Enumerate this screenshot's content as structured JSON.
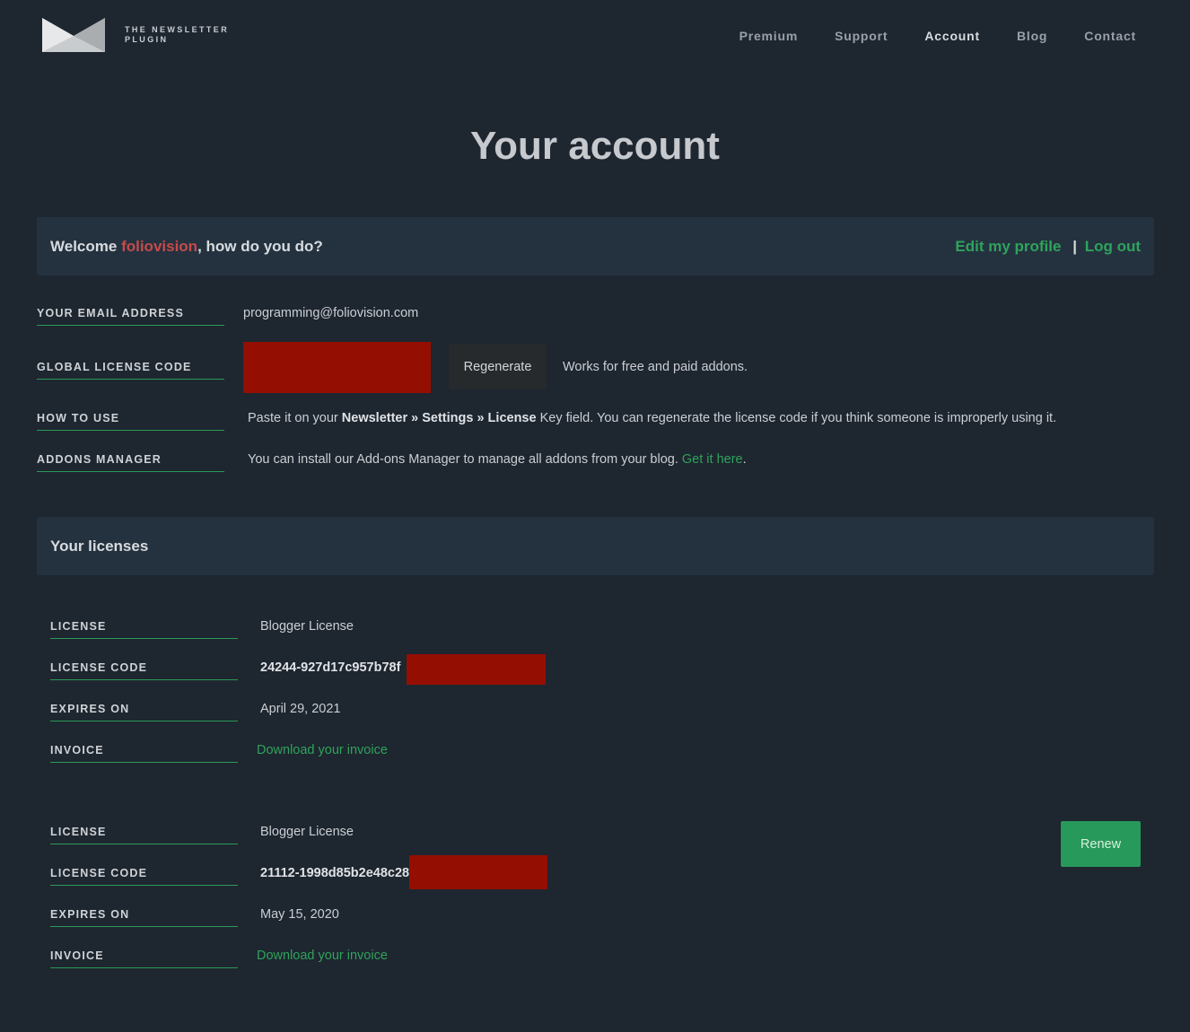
{
  "logo": {
    "line1": "THE NEWSLETTER",
    "line2": "PLUGIN",
    "icon": "envelope-logo-icon"
  },
  "nav": {
    "items": [
      "Premium",
      "Support",
      "Account",
      "Blog",
      "Contact"
    ],
    "active": "Account"
  },
  "page_title": "Your account",
  "welcome": {
    "prefix": "Welcome ",
    "username": "foliovision",
    "suffix": ", how do you do?",
    "edit_profile": "Edit my profile",
    "separator": "|",
    "logout": "Log out"
  },
  "account": {
    "email_label": "YOUR EMAIL ADDRESS",
    "email_value": "programming@foliovision.com",
    "license_label": "GLOBAL LICENSE CODE",
    "regenerate_label": "Regenerate",
    "license_note": "Works for free and paid addons.",
    "howto_label": "HOW TO USE",
    "howto_prefix": "Paste it on your ",
    "howto_bold": "Newsletter » Settings » License",
    "howto_suffix": " Key field. You can regenerate the license code if you think someone is improperly using it.",
    "addons_label": "ADDONS MANAGER",
    "addons_text": "You can install our Add-ons Manager to manage all addons from your blog. ",
    "addons_link": "Get it here",
    "addons_end": "."
  },
  "licenses_title": "Your licenses",
  "field_labels": {
    "license": "LICENSE",
    "code": "LICENSE CODE",
    "expires": "EXPIRES ON",
    "invoice": "INVOICE"
  },
  "licenses": [
    {
      "name": "Blogger License",
      "code": "24244-927d17c957b78f",
      "expires": "April 29, 2021",
      "invoice": "Download your invoice"
    },
    {
      "name": "Blogger License",
      "code": "21112-1998d85b2e48c28",
      "expires": "May 15, 2020",
      "invoice": "Download your invoice",
      "renew": "Renew"
    }
  ],
  "colors": {
    "background": "#1e2630",
    "panel": "#243240",
    "accent_green": "#2fa35b",
    "username_red": "#c64a4a",
    "redaction": "#950e02"
  }
}
